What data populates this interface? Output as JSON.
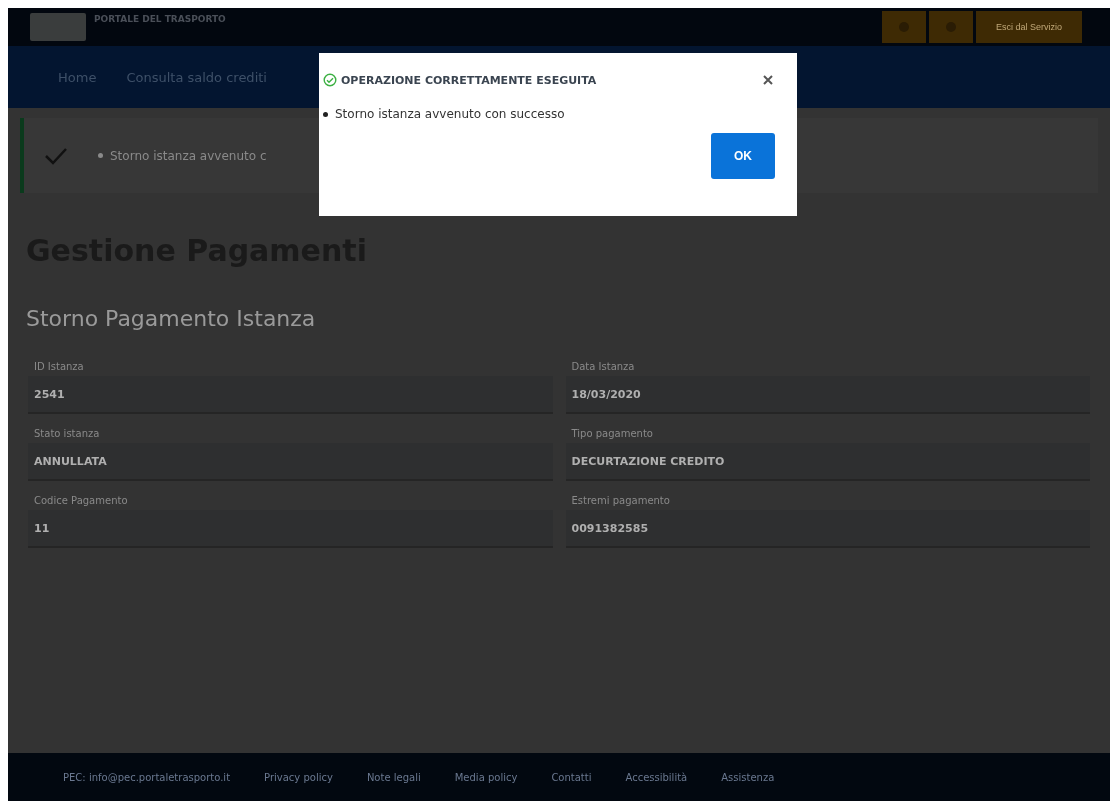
{
  "header": {
    "title": "PORTALE DEL TRASPORTO",
    "buttons": [
      {
        "kind": "icon"
      },
      {
        "kind": "icon"
      },
      {
        "kind": "text",
        "label": "Esci dal Servizio"
      }
    ]
  },
  "nav": {
    "items": [
      {
        "label": "Home"
      },
      {
        "label": "Consulta saldo crediti"
      }
    ]
  },
  "alert": {
    "message": "Storno istanza avvenuto c"
  },
  "page": {
    "title": "Gestione Pagamenti",
    "subtitle": "Storno Pagamento Istanza"
  },
  "fields": [
    {
      "label": "ID Istanza",
      "value": "2541"
    },
    {
      "label": "Data Istanza",
      "value": "18/03/2020"
    },
    {
      "label": "Stato istanza",
      "value": "ANNULLATA"
    },
    {
      "label": "Tipo pagamento",
      "value": "DECURTAZIONE CREDITO"
    },
    {
      "label": "Codice Pagamento",
      "value": "11"
    },
    {
      "label": "Estremi pagamento",
      "value": "0091382585"
    }
  ],
  "footer": {
    "links": [
      "PEC: info@pec.portaletrasporto.it",
      "Privacy policy",
      "Note legali",
      "Media policy",
      "Contatti",
      "Accessibilità",
      "Assistenza"
    ]
  },
  "modal": {
    "title": "OPERAZIONE CORRETTAMENTE ESEGUITA",
    "messages": [
      "Storno istanza avvenuto con successo"
    ],
    "button": "OK"
  }
}
